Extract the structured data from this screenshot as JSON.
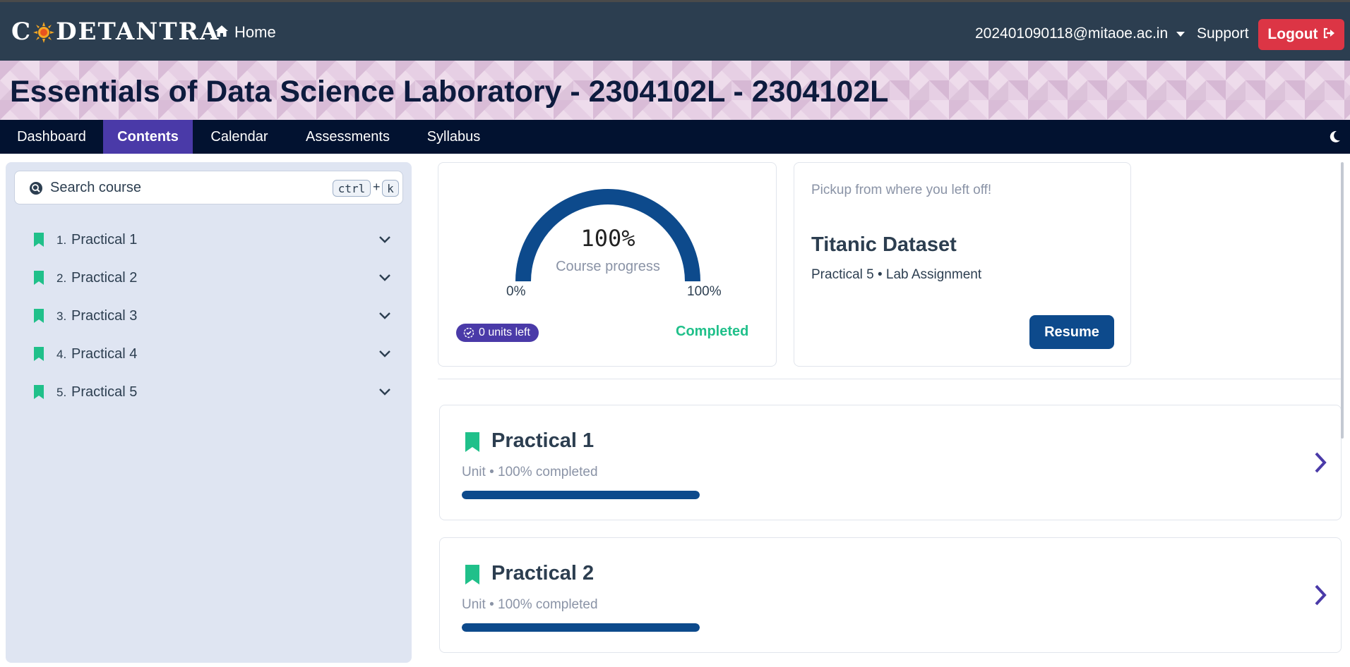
{
  "header": {
    "logo_text_1": "C",
    "logo_text_2": "DETANTRA",
    "home_label": "Home",
    "user_email": "202401090118@mitaoe.ac.in",
    "support_label": "Support",
    "logout_label": "Logout"
  },
  "banner": {
    "course_title": "Essentials of Data Science Laboratory - 2304102L - 2304102L"
  },
  "tabs": [
    {
      "label": "Dashboard",
      "active": false
    },
    {
      "label": "Contents",
      "active": true
    },
    {
      "label": "Calendar",
      "active": false
    },
    {
      "label": "Assessments",
      "active": false
    },
    {
      "label": "Syllabus",
      "active": false
    }
  ],
  "sidebar": {
    "search_placeholder": "Search course",
    "shortcut_key_1": "ctrl",
    "shortcut_plus": "+",
    "shortcut_key_2": "k",
    "items": [
      {
        "number": "1.",
        "label": "Practical 1"
      },
      {
        "number": "2.",
        "label": "Practical 2"
      },
      {
        "number": "3.",
        "label": "Practical 3"
      },
      {
        "number": "4.",
        "label": "Practical 4"
      },
      {
        "number": "5.",
        "label": "Practical 5"
      }
    ]
  },
  "progress": {
    "percent_label": "100%",
    "percent_value": 100,
    "subtitle": "Course progress",
    "min_label": "0%",
    "max_label": "100%",
    "units_left": "0 units left",
    "status": "Completed"
  },
  "resume": {
    "hint": "Pickup from where you left off!",
    "title": "Titanic Dataset",
    "subtitle": "Practical 5 • Lab Assignment",
    "button_label": "Resume"
  },
  "units": [
    {
      "title": "Practical 1",
      "subtitle": "Unit • 100% completed",
      "progress": 1.0
    },
    {
      "title": "Practical 2",
      "subtitle": "Unit • 100% completed",
      "progress": 1.0
    }
  ],
  "colors": {
    "accent": "#4a3aa8",
    "primary": "#0d4a8c",
    "success": "#20c08a",
    "danger": "#dc3545",
    "header_bg": "#2c3e50",
    "tabbar_bg": "#021230"
  }
}
